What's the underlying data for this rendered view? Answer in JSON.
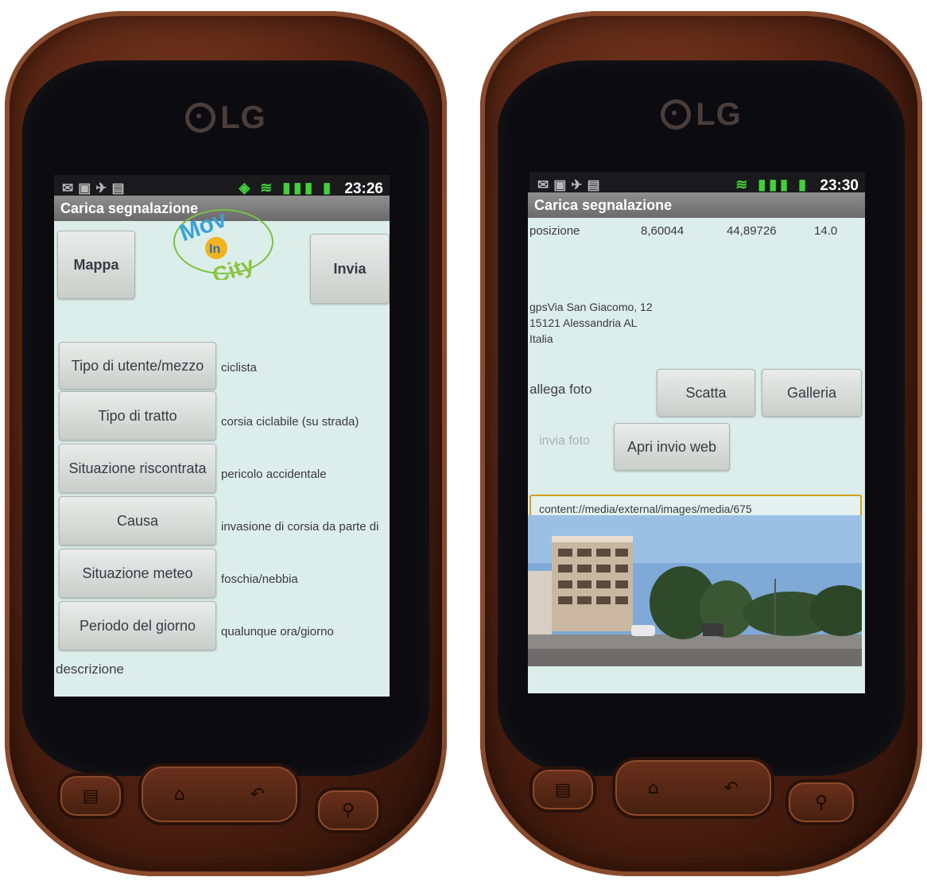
{
  "left_phone": {
    "brand": "LG",
    "status": {
      "time": "23:26"
    },
    "title": "Carica segnalazione",
    "buttons": {
      "map": "Mappa",
      "send": "Invia"
    },
    "app_logo": {
      "word1": "Mov",
      "word2": "In",
      "word3": "City"
    },
    "rows": [
      {
        "label": "Tipo di utente/mezzo",
        "value": "ciclista"
      },
      {
        "label": "Tipo di tratto",
        "value": "corsia ciclabile (su strada)"
      },
      {
        "label": "Situazione riscontrata",
        "value": "pericolo accidentale"
      },
      {
        "label": "Causa",
        "value": "invasione di corsia da parte di"
      },
      {
        "label": "Situazione meteo",
        "value": "foschia/nebbia"
      },
      {
        "label": "Periodo del giorno",
        "value": "qualunque ora/giorno"
      }
    ],
    "description_label": "descrizione"
  },
  "right_phone": {
    "brand": "LG",
    "status": {
      "time": "23:30"
    },
    "title": "Carica segnalazione",
    "position": {
      "label": "posizione",
      "lon": "8,60044",
      "lat": "44,89726",
      "acc": "14.0"
    },
    "address": {
      "line1": "gpsVia San Giacomo, 12",
      "line2": "15121 Alessandria AL",
      "line3": "Italia"
    },
    "attach_label": "allega foto",
    "buttons": {
      "shoot": "Scatta",
      "gallery": "Galleria",
      "send_photo": "invia foto",
      "open_web": "Apri invio web"
    },
    "uri": "content://media/external/images/media/675"
  },
  "colors": {
    "accent_border": "#d4a017",
    "status_green": "#42d13a",
    "screen_bg": "#dceeea",
    "body_copper": "#5a2614"
  }
}
